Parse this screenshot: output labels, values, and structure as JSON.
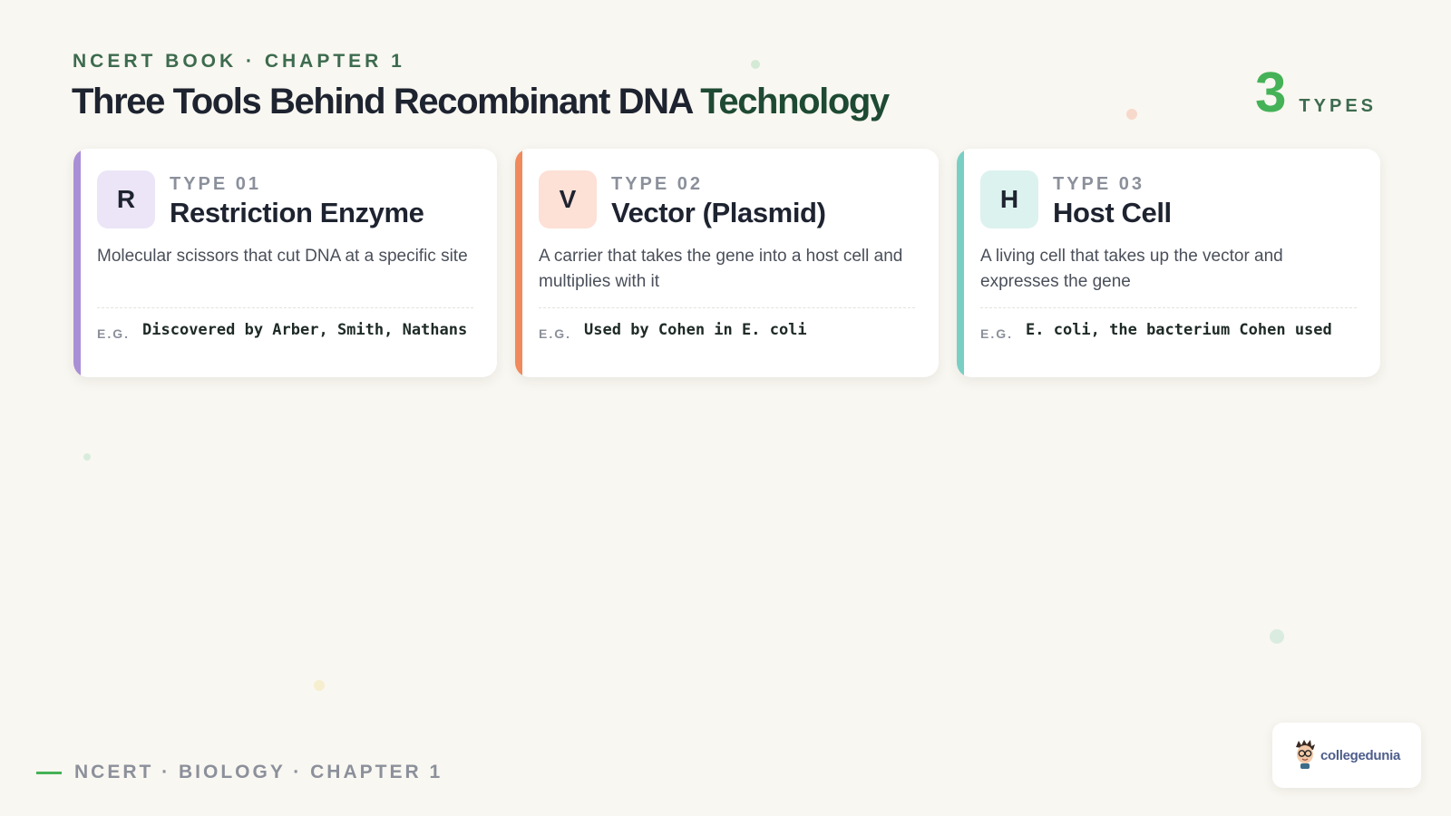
{
  "header": {
    "eyebrow": "NCERT BOOK · CHAPTER 1",
    "title_main": "Three Tools Behind Recombinant DNA ",
    "title_accent": "Technology",
    "count_number": "3",
    "count_label": "TYPES"
  },
  "cards": [
    {
      "badge": "R",
      "type_label": "TYPE 01",
      "title": "Restriction Enzyme",
      "description": "Molecular scissors that cut DNA at a specific site",
      "eg_label": "E.G.",
      "example": "Discovered by Arber, Smith, Nathans",
      "accent_color": "#a98fd6",
      "badge_bg": "#ebe5f7"
    },
    {
      "badge": "V",
      "type_label": "TYPE 02",
      "title": "Vector (Plasmid)",
      "description": "A carrier that takes the gene into a host cell and multiplies with it",
      "eg_label": "E.G.",
      "example": "Used by Cohen in E. coli",
      "accent_color": "#f08a5d",
      "badge_bg": "#fde0d6"
    },
    {
      "badge": "H",
      "type_label": "TYPE 03",
      "title": "Host Cell",
      "description": "A living cell that takes up the vector and expresses the gene",
      "eg_label": "E.G.",
      "example": "E. coli, the bacterium Cohen used",
      "accent_color": "#79cfc4",
      "badge_bg": "#dcf2ee"
    }
  ],
  "footer": {
    "text": "NCERT · BIOLOGY · CHAPTER 1"
  },
  "logo": {
    "text": "collegedunia",
    "icon": "mascot-icon"
  },
  "colors": {
    "background": "#f9f7f1",
    "brand_green": "#45b257",
    "dark_green": "#1e4a33"
  }
}
